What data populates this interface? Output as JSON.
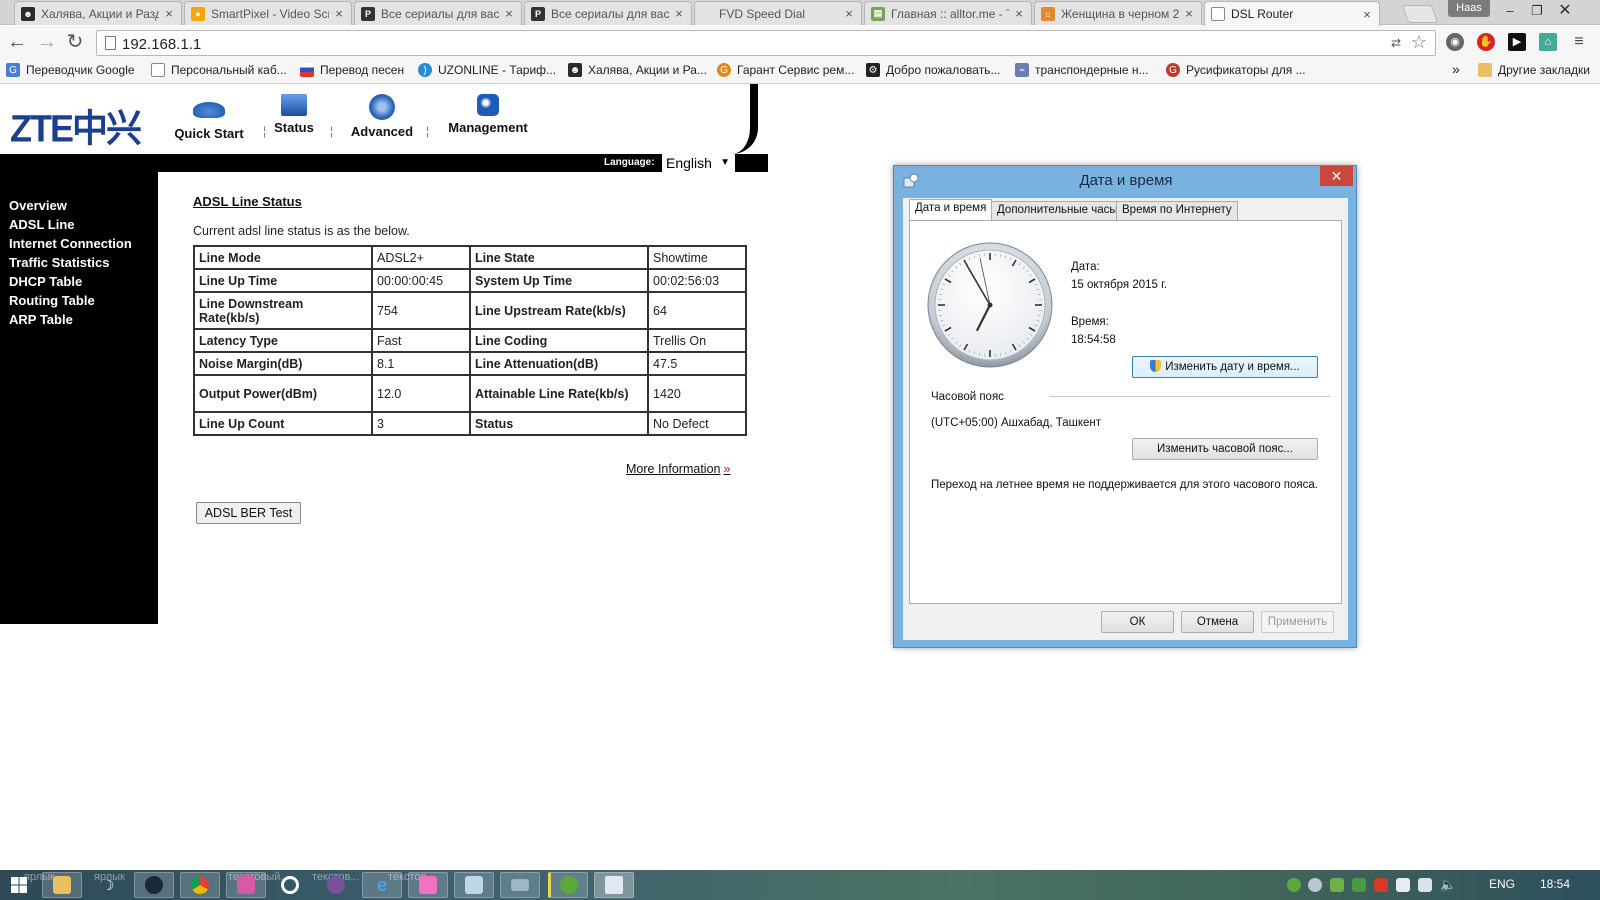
{
  "browser": {
    "tabs": [
      {
        "title": "Халява, Акции и Разд",
        "icon": "alien-icon",
        "color": "#2b2b2b"
      },
      {
        "title": "SmartPixel - Video Scr",
        "icon": "smartpixel-icon",
        "color": "#f5a700"
      },
      {
        "title": "Все сериалы для вас",
        "icon": "p-icon",
        "color": "#333333"
      },
      {
        "title": "Все сериалы для вас",
        "icon": "p-icon",
        "color": "#333333"
      },
      {
        "title": "FVD Speed Dial",
        "icon": "",
        "color": ""
      },
      {
        "title": "Главная :: alltor.me - Т",
        "icon": "alltor-icon",
        "color": "#7aa05a"
      },
      {
        "title": "Женщина в черном 2",
        "icon": "home-icon",
        "color": "#e28a2b"
      },
      {
        "title": "DSL Router",
        "icon": "page-icon",
        "color": "#ffffff"
      }
    ],
    "user": "Haas",
    "url": "192.168.1.1",
    "bookmarks": [
      {
        "label": "Переводчик Google",
        "color": "#4a7fd8"
      },
      {
        "label": "Персональный каб...",
        "color": "#ffffff"
      },
      {
        "label": "Перевод песен",
        "color": "#d33"
      },
      {
        "label": "UZONLINE - Тариф...",
        "color": "#2a8ad4"
      },
      {
        "label": "Халява, Акции и Ра...",
        "color": "#2b2b2b"
      },
      {
        "label": "Гарант Сервис рем...",
        "color": "#e08a1b"
      },
      {
        "label": "Добро пожаловать...",
        "color": "#222"
      },
      {
        "label": "транспондерные н...",
        "color": "#6a7fb0"
      },
      {
        "label": "Русификаторы для ...",
        "color": "#c0392b"
      }
    ],
    "bookmarks_overflow": "»",
    "other_bookmarks": "Другие закладки"
  },
  "router": {
    "logo": "ZTE中兴",
    "nav": [
      {
        "label": "Quick Start",
        "color": "#2a6fc9"
      },
      {
        "label": "Status",
        "color": "#2a6fc9"
      },
      {
        "label": "Advanced",
        "color": "#2a6fc9"
      },
      {
        "label": "Management",
        "color": "#2a6fc9"
      }
    ],
    "language_label": "Language:",
    "language_value": "English",
    "sidebar": [
      "Overview",
      "ADSL Line",
      "Internet Connection",
      "Traffic Statistics",
      "DHCP Table",
      "Routing Table",
      "ARP Table"
    ],
    "title": "ADSL Line Status",
    "description": "Current adsl line status is as the below.",
    "table": [
      [
        "Line Mode",
        "ADSL2+",
        "Line State",
        "Showtime"
      ],
      [
        "Line Up Time",
        "00:00:00:45",
        "System Up Time",
        "00:02:56:03"
      ],
      [
        "Line Downstream Rate(kb/s)",
        "754",
        "Line Upstream Rate(kb/s)",
        "64"
      ],
      [
        "Latency Type",
        "Fast",
        "Line Coding",
        "Trellis On"
      ],
      [
        "Noise Margin(dB)",
        "8.1",
        "Line Attenuation(dB)",
        "47.5"
      ],
      [
        "Output Power(dBm)",
        "12.0",
        "Attainable Line Rate(kb/s)",
        "1420"
      ],
      [
        "Line Up Count",
        "3",
        "Status",
        "No Defect"
      ]
    ],
    "more_info": "More Information",
    "ber_button": "ADSL BER Test"
  },
  "dialog": {
    "title": "Дата и время",
    "tabs": [
      "Дата и время",
      "Дополнительные часы",
      "Время по Интернету"
    ],
    "date_label": "Дата:",
    "date_value": "15 октября 2015 г.",
    "time_label": "Время:",
    "time_value": "18:54:58",
    "change_datetime": "Изменить дату и время...",
    "tz_header": "Часовой пояс",
    "tz_value": "(UTC+05:00) Ашхабад, Ташкент",
    "change_tz": "Изменить часовой пояс...",
    "dst_note": "Переход на летнее время не поддерживается для этого часового пояса.",
    "ok": "ОК",
    "cancel": "Отмена",
    "apply": "Применить",
    "clock": {
      "hour": 18,
      "minute": 54,
      "second": 58
    }
  },
  "taskbar": {
    "ghost_labels": [
      "ярлык",
      "ярлык",
      "текстовый...",
      "текстов...",
      "текстов..."
    ],
    "language": "ENG",
    "time": "18:54"
  }
}
